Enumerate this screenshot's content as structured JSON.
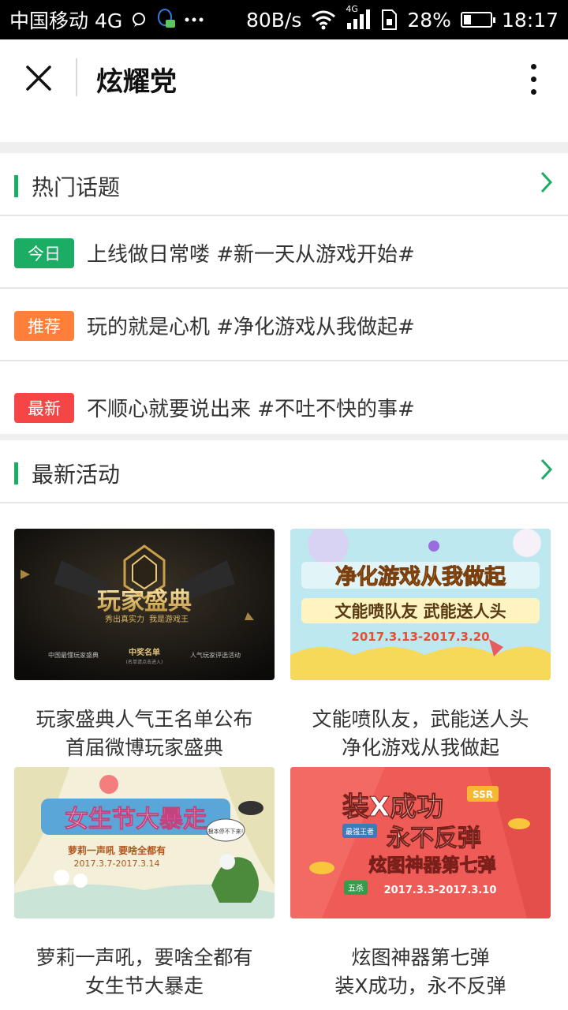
{
  "status_bar": {
    "carrier": "中国移动 4G",
    "speed": "80B/s",
    "net_badge": "4G",
    "battery": "28%",
    "battery_level": 0.28,
    "time": "18:17"
  },
  "header": {
    "title": "炫耀党"
  },
  "hot_topics": {
    "title": "热门话题",
    "items": [
      {
        "badge": "今日",
        "badge_color": "#1aad63",
        "text": "上线做日常喽 #新一天从游戏开始#"
      },
      {
        "badge": "推荐",
        "badge_color": "#ff7e3a",
        "text": "玩的就是心机 #净化游戏从我做起#"
      },
      {
        "badge": "最新",
        "badge_color": "#f54545",
        "text": "不顺心就要说出来 #不吐不快的事#"
      }
    ]
  },
  "activities": {
    "title": "最新活动",
    "items": [
      {
        "image_text": {
          "main": "玩家盛典",
          "sub1": "秀出真实力",
          "sub2": "我是游戏王",
          "b1": "中国最懂玩家盛典",
          "b2": "中奖名单",
          "b2s": "(名单请点击进入)",
          "b3": "人气玩家评选活动"
        },
        "line1": "玩家盛典人气王名单公布",
        "line2": "首届微博玩家盛典"
      },
      {
        "image_text": {
          "main1": "净化游戏从我做起",
          "main2": "文能喷队友 武能送人头",
          "date": "2017.3.13-2017.3.20"
        },
        "line1": "文能喷队友，武能送人头",
        "line2": "净化游戏从我做起"
      },
      {
        "image_text": {
          "main": "女生节大暴走",
          "sub": "萝莉一声吼 要啥全都有",
          "date": "2017.3.7-2017.3.14",
          "bubble": "根本停不下来!"
        },
        "line1": "萝莉一声吼，要啥全都有",
        "line2": "女生节大暴走"
      },
      {
        "image_text": {
          "l1": "装X成功",
          "l2": "永不反弹",
          "l3": "炫图神器第七弹",
          "date": "2017.3.3-2017.3.10",
          "tag1": "SSR",
          "tag2": "最强王者",
          "tag3": "五杀"
        },
        "line1": "炫图神器第七弹",
        "line2": "装X成功，永不反弹"
      }
    ]
  }
}
